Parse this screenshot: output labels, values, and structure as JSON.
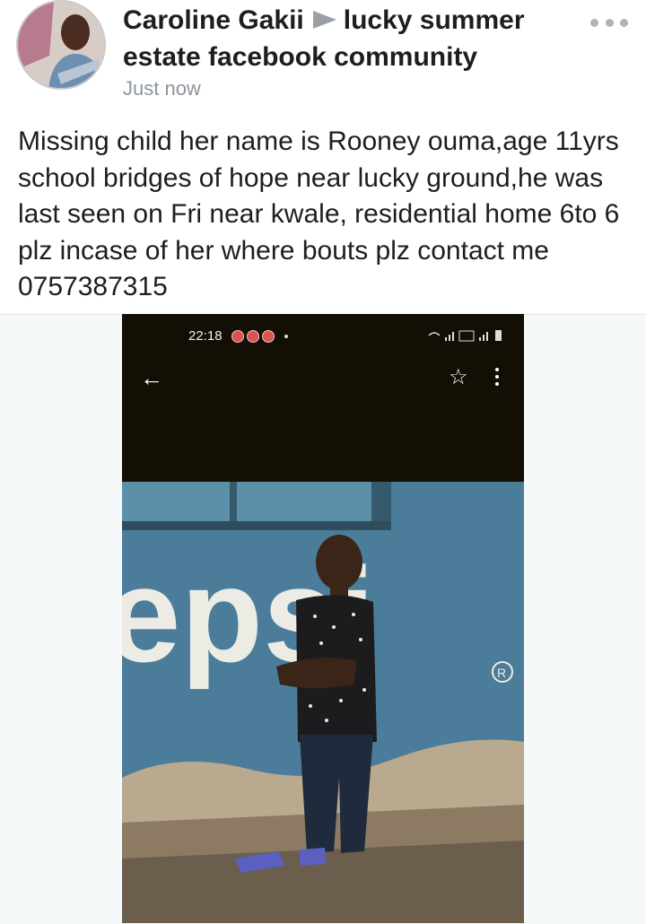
{
  "post": {
    "author": "Caroline Gakii",
    "group": "lucky summer estate facebook community",
    "time": "Just now",
    "text": "Missing child her name is Rooney ouma,age 11yrs school bridges of hope near lucky ground,he was last seen on Fri near kwale, residential home 6to 6 plz incase of her where bouts plz contact me 0757387315"
  },
  "icons": {
    "more": "more-dots-icon",
    "shared_to": "triangle-arrow-icon"
  },
  "photo": {
    "status_time": "22:18",
    "toolbar_icons": [
      "back-arrow-icon",
      "star-icon",
      "kebab-menu-icon"
    ],
    "wall_text": "epsi"
  },
  "colors": {
    "text": "#1c1e21",
    "meta": "#8d949e",
    "phone_bg": "#140f05",
    "wall_blue": "#4b7d9a"
  }
}
